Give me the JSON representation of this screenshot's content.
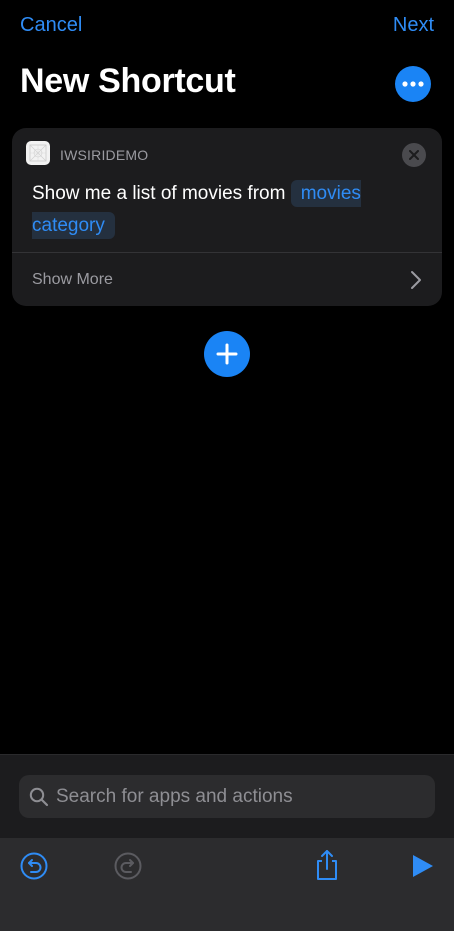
{
  "nav": {
    "cancel_label": "Cancel",
    "next_label": "Next",
    "title": "New Shortcut",
    "more_icon": "ellipsis-icon"
  },
  "action_card": {
    "app_name": "IWSIRIDEMO",
    "text_prefix": "Show me a list of movies from",
    "token_label": "movies category",
    "show_more_label": "Show More"
  },
  "search": {
    "placeholder": "Search for apps and actions"
  },
  "toolbar": {
    "items": [
      "undo-icon",
      "redo-icon",
      "share-icon",
      "play-icon"
    ]
  },
  "colors": {
    "accent": "#1a84f5",
    "link": "#2f8cf5",
    "background": "#000000",
    "card": "#1c1c1e",
    "muted_text": "#9b9ba1"
  }
}
